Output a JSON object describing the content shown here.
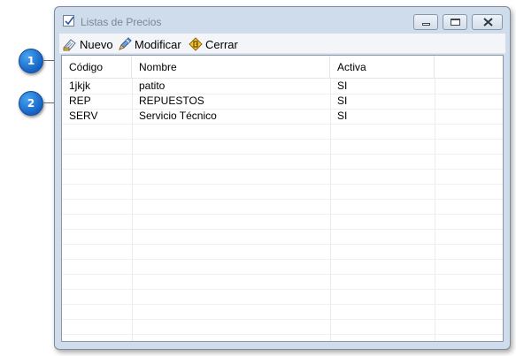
{
  "window": {
    "title": "Listas de Precios"
  },
  "callouts": [
    "1",
    "2"
  ],
  "toolbar": [
    {
      "label": "Nuevo",
      "icon": "new-document-icon"
    },
    {
      "label": "Modificar",
      "icon": "edit-pencil-icon"
    },
    {
      "label": "Cerrar",
      "icon": "close-door-icon"
    }
  ],
  "grid": {
    "columns": [
      "Código",
      "Nombre",
      "Activa"
    ],
    "rows": [
      [
        "1jkjk",
        "patito",
        "SI"
      ],
      [
        "REP",
        "REPUESTOS",
        "SI"
      ],
      [
        "SERV",
        "Servicio Técnico",
        "SI"
      ]
    ]
  }
}
